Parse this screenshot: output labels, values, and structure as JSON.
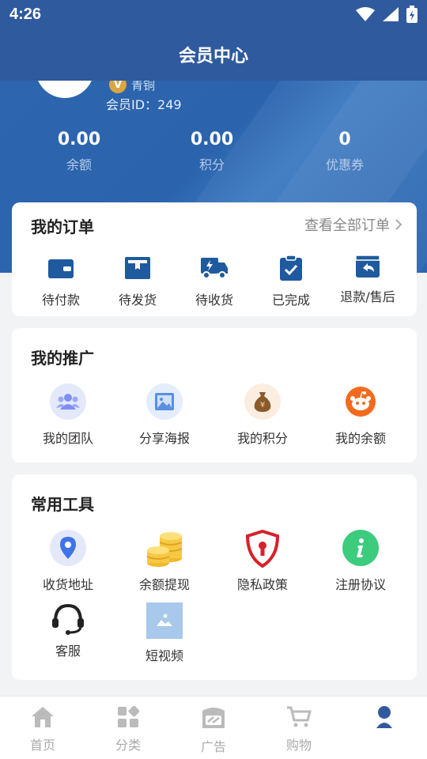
{
  "status_bar": {
    "time": "4:26"
  },
  "nav": {
    "title": "会员中心"
  },
  "profile": {
    "level": "青铜",
    "member_id": "会员ID：249"
  },
  "stats": [
    {
      "value": "0.00",
      "label": "余额"
    },
    {
      "value": "0.00",
      "label": "积分"
    },
    {
      "value": "0",
      "label": "优惠券"
    }
  ],
  "orders": {
    "title": "我的订单",
    "view_all": "查看全部订单",
    "items": [
      {
        "label": "待付款",
        "icon": "wallet-icon"
      },
      {
        "label": "待发货",
        "icon": "box-icon"
      },
      {
        "label": "待收货",
        "icon": "truck-icon"
      },
      {
        "label": "已完成",
        "icon": "clipboard-check-icon"
      },
      {
        "label": "退款/售后",
        "icon": "return-icon"
      }
    ]
  },
  "promotion": {
    "title": "我的推广",
    "items": [
      {
        "label": "我的团队",
        "icon": "team-icon",
        "color": "#7d8ff0"
      },
      {
        "label": "分享海报",
        "icon": "image-icon",
        "color": "#5b8fe0"
      },
      {
        "label": "我的积分",
        "icon": "money-bag-icon",
        "color": "#8a5a2b"
      },
      {
        "label": "我的余额",
        "icon": "reddit-icon",
        "color": "#f26b1d"
      }
    ]
  },
  "tools": {
    "title": "常用工具",
    "items": [
      {
        "label": "收货地址",
        "icon": "location-icon"
      },
      {
        "label": "余额提现",
        "icon": "coins-icon"
      },
      {
        "label": "隐私政策",
        "icon": "shield-lock-icon"
      },
      {
        "label": "注册协议",
        "icon": "info-icon"
      },
      {
        "label": "客服",
        "icon": "headset-icon"
      },
      {
        "label": "短视频",
        "icon": "image-placeholder-icon"
      }
    ]
  },
  "tabbar": [
    {
      "label": "首页",
      "icon": "home-icon"
    },
    {
      "label": "分类",
      "icon": "category-icon"
    },
    {
      "label": "广告",
      "icon": "ad-icon"
    },
    {
      "label": "购物",
      "icon": "cart-icon"
    },
    {
      "label": "",
      "icon": "profile-icon"
    }
  ],
  "colors": {
    "primary": "#2f5a9e",
    "icon_blue": "#1f5a9e"
  }
}
